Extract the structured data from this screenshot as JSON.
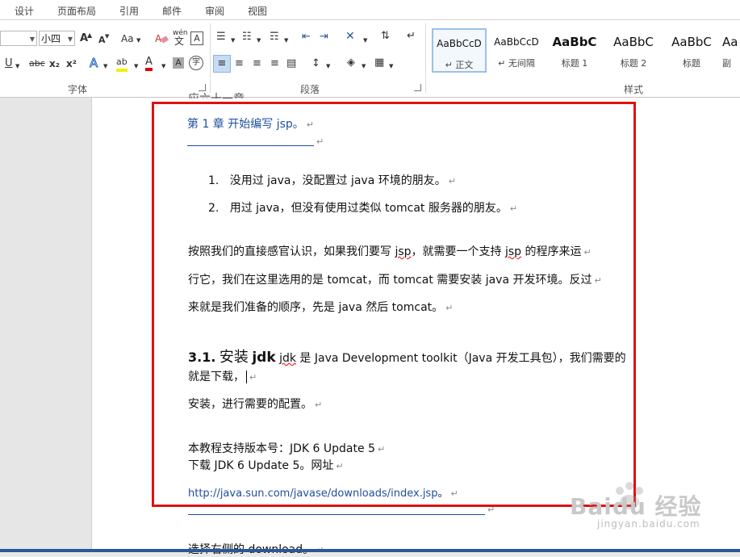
{
  "ribbon_tabs": [
    "设计",
    "页面布局",
    "引用",
    "邮件",
    "审阅",
    "视图"
  ],
  "font_group": {
    "label": "字体",
    "font_name_value": "",
    "font_size_value": "小四",
    "grow_font": "A",
    "shrink_font": "A",
    "change_case": "Aa",
    "clear_format": "A",
    "phonetic": "wén",
    "char_border": "A",
    "underline": "U",
    "strikethrough": "abc",
    "subscript": "x₂",
    "superscript": "x²",
    "text_effect": "A",
    "highlight": "ab",
    "font_color": "A",
    "char_shading": "A",
    "enclose_char": "字"
  },
  "paragraph_group": {
    "label": "段落"
  },
  "styles_group": {
    "label": "样式",
    "items": [
      {
        "sample": "AaBbCcD",
        "name": "↵ 正文"
      },
      {
        "sample": "AaBbCcD",
        "name": "↵ 无间隔"
      },
      {
        "sample": "AaBbC",
        "name": "标题 1"
      },
      {
        "sample": "AaBbC",
        "name": "标题 2"
      },
      {
        "sample": "AaBbC",
        "name": "标题"
      },
      {
        "sample": "Aa",
        "name": "副"
      }
    ]
  },
  "document": {
    "top_partial": "应六十一章。",
    "chapter_title": "第 1 章 开始编写 jsp。",
    "list_items": [
      {
        "num": "1.",
        "text": "没用过 java，没配置过 java 环境的朋友。"
      },
      {
        "num": "2.",
        "text": "用过 java，但没有使用过类似 tomcat 服务器的朋友。"
      }
    ],
    "para1": {
      "l1_a": "按照我们的直接感官认识，如果我们要写 ",
      "l1_jsp1": "jsp",
      "l1_b": "，就需要一个支持 ",
      "l1_jsp2": "jsp",
      "l1_c": " 的程序来运",
      "l2": "行它，我们在这里选用的是 tomcat，而 tomcat 需要安装 java 开发环境。反过",
      "l3": "来就是我们准备的顺序，先是 java 然后 tomcat。"
    },
    "section": {
      "num": "3.1.",
      "title_cn": "安装",
      "title_en": "jdk",
      "desc_jdk": "jdk",
      "desc_rest": " 是 Java Development toolkit（Java 开发工具包），我们需要的",
      "line2": "就是下载，",
      "line3": "安装，进行需要的配置。"
    },
    "version_line": "本教程支持版本号：JDK 6 Update 5",
    "download_line": "下载 JDK 6 Update 5。网址",
    "url": "http://java.sun.com/javase/downloads/index.jsp",
    "url_suffix": "。",
    "bottom_line": "选择右侧的 download。"
  },
  "watermark": {
    "text": "Baidu 经验",
    "sub": "jingyan.baidu.com"
  },
  "colors": {
    "accent": "#2b579a",
    "link": "#1f4f9e",
    "highlight_box": "#e01010"
  }
}
